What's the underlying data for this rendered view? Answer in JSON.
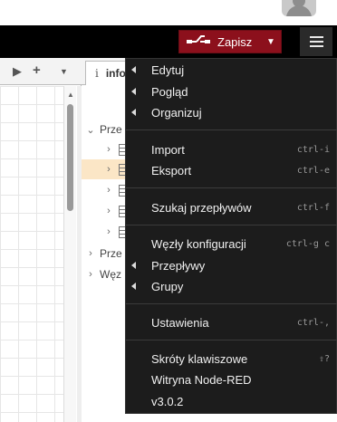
{
  "header": {
    "deploy_label": "Zapisz"
  },
  "sidebar": {
    "tab_label": "info",
    "tree": [
      {
        "label": "Prze",
        "expanded": true
      },
      {
        "label": "",
        "selected": false
      },
      {
        "label": "",
        "selected": true
      },
      {
        "label": "",
        "selected": false
      },
      {
        "label": "",
        "selected": false
      },
      {
        "label": "",
        "selected": false
      },
      {
        "label": "Prze",
        "expanded": false
      },
      {
        "label": "Węz",
        "expanded": false
      }
    ]
  },
  "menu": {
    "items": [
      {
        "label": "Edytuj",
        "submenu": true,
        "shortcut": ""
      },
      {
        "label": "Pogląd",
        "submenu": true,
        "shortcut": ""
      },
      {
        "label": "Organizuj",
        "submenu": true,
        "shortcut": ""
      },
      {
        "label": "Import",
        "submenu": false,
        "shortcut": "ctrl-i"
      },
      {
        "label": "Eksport",
        "submenu": false,
        "shortcut": "ctrl-e"
      },
      {
        "label": "Szukaj przepływów",
        "submenu": false,
        "shortcut": "ctrl-f"
      },
      {
        "label": "Węzły konfiguracji",
        "submenu": false,
        "shortcut": "ctrl-g c"
      },
      {
        "label": "Przepływy",
        "submenu": true,
        "shortcut": ""
      },
      {
        "label": "Grupy",
        "submenu": true,
        "shortcut": ""
      },
      {
        "label": "Ustawienia",
        "submenu": false,
        "shortcut": "ctrl-,"
      },
      {
        "label": "Skróty klawiszowe",
        "submenu": false,
        "shortcut": "⇧?"
      },
      {
        "label": "Witryna Node-RED",
        "submenu": false,
        "shortcut": ""
      },
      {
        "label": "v3.0.2",
        "submenu": false,
        "shortcut": ""
      }
    ]
  },
  "colors": {
    "header_bg": "#000000",
    "deploy_bg": "#8c101c",
    "menu_bg": "#1c1c1c",
    "selection": "#fbe6c6"
  }
}
